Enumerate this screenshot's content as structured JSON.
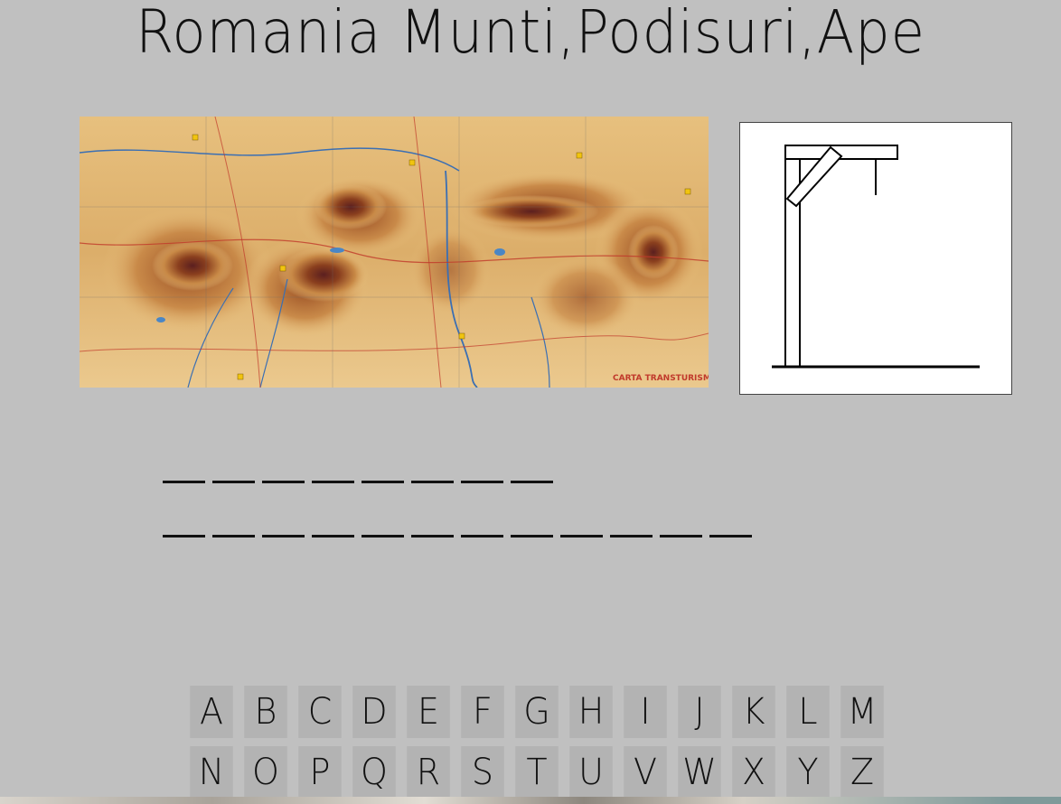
{
  "title": "Romania Munti,Podisuri,Ape",
  "map": {
    "alt_label": "CARTA TRANSTURISM",
    "colors": {
      "low": "#e9c27f",
      "mid": "#c88946",
      "high": "#7a3a1a",
      "peak": "#5b1f1f"
    }
  },
  "word": {
    "row1": [
      "",
      "",
      "",
      "",
      "",
      "",
      "",
      ""
    ],
    "row2": [
      "",
      "",
      "",
      "",
      "",
      "",
      "",
      "",
      "",
      "",
      "",
      ""
    ]
  },
  "keyboard": {
    "row1": [
      "A",
      "B",
      "C",
      "D",
      "E",
      "F",
      "G",
      "H",
      "I",
      "J",
      "K",
      "L",
      "M"
    ],
    "row2": [
      "N",
      "O",
      "P",
      "Q",
      "R",
      "S",
      "T",
      "U",
      "V",
      "W",
      "X",
      "Y",
      "Z"
    ]
  },
  "hangman": {
    "wrong_guesses": 0
  }
}
